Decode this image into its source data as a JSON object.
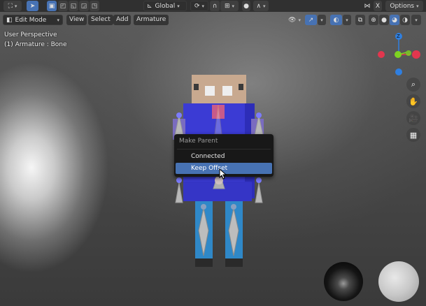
{
  "header": {
    "transform_orientation": "Global",
    "options_label": "Options",
    "mode_label": "Edit Mode",
    "menus": [
      "View",
      "Select",
      "Add",
      "Armature"
    ]
  },
  "overlay": {
    "perspective": "User Perspective",
    "selection": "(1) Armature : Bone"
  },
  "gizmo": {
    "z_label": "Z",
    "y_label": "Y",
    "x_label": "X"
  },
  "context_menu": {
    "title": "Make Parent",
    "items": [
      {
        "label": "Connected",
        "highlighted": false
      },
      {
        "label": "Keep Offset",
        "highlighted": true
      }
    ]
  },
  "colors": {
    "accent": "#4772b3",
    "axis_x": "#e2364e",
    "axis_y": "#7ed321",
    "axis_z": "#2f7fe0",
    "menu_bg": "#181818"
  }
}
